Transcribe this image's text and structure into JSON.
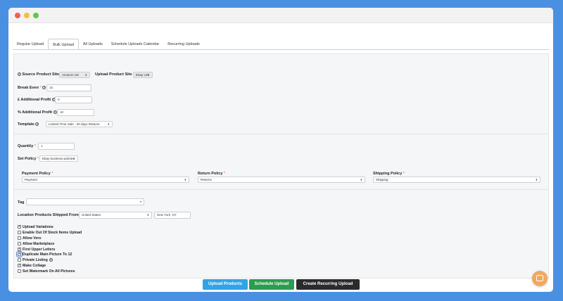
{
  "tabs": [
    "Regular Upload",
    "Bulk Upload",
    "All Uploads",
    "Schedule Uploads Calendar",
    "Recurring Uploads"
  ],
  "form": {
    "source_site_label": "Source Product Site",
    "source_site_value": "Amazon US",
    "upload_site_label": "Upload Product Site",
    "upload_site_value": "Ebay US",
    "break_even_label": "Break Even",
    "break_even_value": "15",
    "add_profit_abs_label": "£ Additional Profit",
    "add_profit_abs_value": "0",
    "add_profit_pct_label": "% Additional Profit",
    "add_profit_pct_value": "10",
    "template_label": "Template",
    "template_value": "Limited Time Sale - 30 days Returns",
    "quantity_label": "Quantity",
    "quantity_value": "1",
    "set_policy_label": "Set Policy",
    "set_policy_value": "Ebay business policies",
    "payment_policy_label": "Payment Policy",
    "payment_policy_value": "Payment",
    "return_policy_label": "Return Policy",
    "return_policy_value": "Returns",
    "shipping_policy_label": "Shipping Policy",
    "shipping_policy_value": "Shipping",
    "tag_label": "Tag",
    "location_label": "Location Products Shipped From",
    "location_country": "United States",
    "location_city": "New York, NY"
  },
  "checkboxes": [
    {
      "label": "Upload Variations",
      "checked": true
    },
    {
      "label": "Enable Out Of Stock Items Upload",
      "checked": false
    },
    {
      "label": "Allow Vero",
      "checked": false
    },
    {
      "label": "Allow Marketplace",
      "checked": false
    },
    {
      "label": "First Upper Letters",
      "checked": true
    },
    {
      "label": "Duplicate Main Picture To 12",
      "checked": true
    },
    {
      "label": "Private Listing",
      "checked": false
    },
    {
      "label": "Make Collage",
      "checked": true
    },
    {
      "label": "Set Watermark On All Pictures",
      "checked": false
    }
  ],
  "buttons": {
    "upload": "Upload Products",
    "schedule": "Schedule Upload",
    "recurring": "Create Recurring Upload"
  },
  "colors": {
    "upload": "#2fa4e7",
    "schedule": "#2a9d4e",
    "recurring": "#2b2b2b",
    "background": "#4a90e2"
  }
}
